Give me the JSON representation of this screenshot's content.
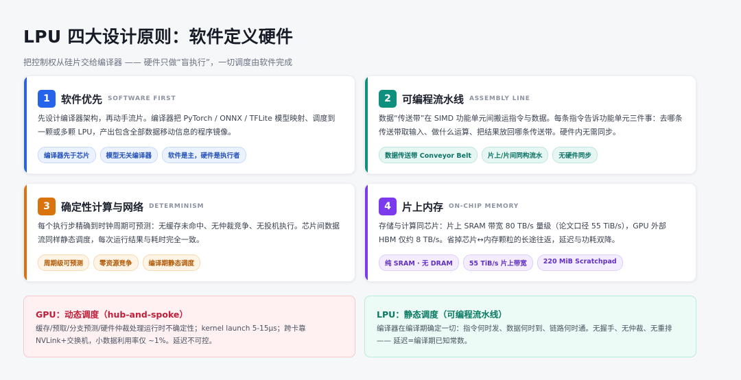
{
  "header": {
    "title": "LPU 四大设计原则：软件定义硬件",
    "subtitle": "把控制权从硅片交给编译器 —— 硬件只做“盲执行”，一切调度由软件完成"
  },
  "cards": [
    {
      "num": "1",
      "title": "软件优先",
      "tag": "SOFTWARE FIRST",
      "desc": "先设计编译器架构，再动手流片。编译器把 PyTorch / ONNX / TFLite 模型映射、调度到一颗或多颗 LPU，产出包含全部数据移动信息的程序镜像。",
      "chips": [
        "编译器先于芯片",
        "模型无关编译器",
        "软件是主，硬件是执行者"
      ],
      "accent": "#2563eb"
    },
    {
      "num": "2",
      "title": "可编程流水线",
      "tag": "ASSEMBLY LINE",
      "desc": "数据“传送带”在 SIMD 功能单元间搬运指令与数据。每条指令告诉功能单元三件事：去哪条传送带取输入、做什么运算、把结果放回哪条传送带。硬件内无需同步。",
      "chips": [
        "数据传送带 Conveyor Belt",
        "片上/片间同构流水",
        "无硬件同步"
      ],
      "accent": "#0f8f7e"
    },
    {
      "num": "3",
      "title": "确定性计算与网络",
      "tag": "DETERMINISM",
      "desc": "每个执行步精确到时钟周期可预测：无缓存未命中、无仲裁竞争、无投机执行。芯片间数据流同样静态调度，每次运行结果与耗时完全一致。",
      "chips": [
        "周期级可预测",
        "零资源竞争",
        "编译期静态调度"
      ],
      "accent": "#d9730d"
    },
    {
      "num": "4",
      "title": "片上内存",
      "tag": "ON-CHIP MEMORY",
      "desc": "存储与计算同芯片：片上 SRAM 带宽 80 TB/s 量级（论文口径 55 TiB/s），GPU 外部 HBM 仅约 8 TB/s。省掉芯片↔内存颗粒的长途往返，延迟与功耗双降。",
      "chips": [
        "纯 SRAM · 无 DRAM",
        "55 TiB/s 片上带宽",
        "220 MiB Scratchpad"
      ],
      "accent": "#7c3aed"
    }
  ],
  "notes": {
    "gpu": {
      "title": "GPU：动态调度（hub-and-spoke）",
      "text": "缓存/预取/分支预测/硬件仲裁处理运行时不确定性；kernel launch 5-15μs；跨卡靠 NVLink+交换机，小数据利用率仅 ~1%。延迟不可控。"
    },
    "lpu": {
      "title": "LPU：静态调度（可编程流水线）",
      "text": "编译器在编译期确定一切：指令何时发、数据何时到、链路何时通。无握手、无仲裁、无重排 —— 延迟=编译期已知常数。"
    }
  }
}
